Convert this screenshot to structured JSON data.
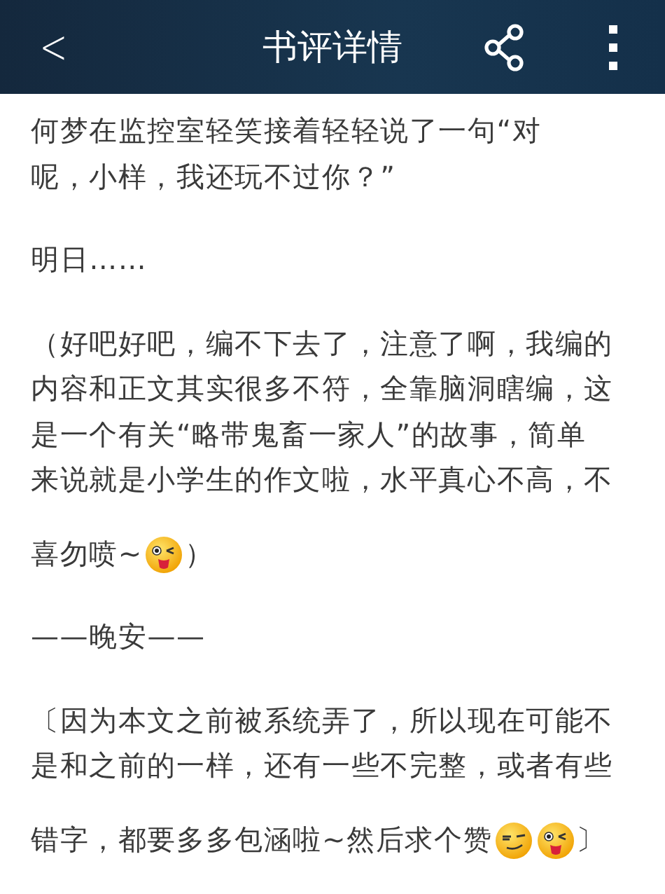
{
  "header": {
    "back": "<",
    "title": "书评详情"
  },
  "paragraphs": [
    {
      "lines": [
        [
          {
            "kind": "text",
            "text": "何梦在监控室轻笑接着轻轻说了一句“对"
          }
        ],
        [
          {
            "kind": "text",
            "text": "呢，小样，我还玩不过你？”"
          }
        ]
      ]
    },
    {
      "lines": [
        [
          {
            "kind": "text",
            "text": "明日……"
          }
        ]
      ]
    },
    {
      "lines": [
        [
          {
            "kind": "text",
            "text": "（好吧好吧，编不下去了，注意了啊，我编的"
          }
        ],
        [
          {
            "kind": "text",
            "text": "内容和正文其实很多不符，全靠脑洞瞎编，这"
          }
        ],
        [
          {
            "kind": "text",
            "text": "是一个有关“略带鬼畜一家人”的故事，简单"
          }
        ],
        [
          {
            "kind": "text",
            "text": "来说就是小学生的作文啦，水平真心不高，不"
          }
        ],
        [
          {
            "kind": "text",
            "text": "喜勿喷~"
          },
          {
            "kind": "tongue"
          },
          {
            "kind": "text",
            "text": "）"
          }
        ]
      ]
    },
    {
      "lines": [
        [
          {
            "kind": "text",
            "text": "——晚安——"
          }
        ]
      ]
    },
    {
      "lines": [
        [
          {
            "kind": "text",
            "text": "〔因为本文之前被系统弄了，所以现在可能不"
          }
        ],
        [
          {
            "kind": "text",
            "text": "是和之前的一样，还有一些不完整，或者有些"
          }
        ],
        [
          {
            "kind": "text",
            "text": "错字，都要多多包涵啦~然后求个赞"
          },
          {
            "kind": "smirk"
          },
          {
            "kind": "tongue"
          },
          {
            "kind": "text",
            "text": "〕"
          }
        ]
      ]
    }
  ]
}
